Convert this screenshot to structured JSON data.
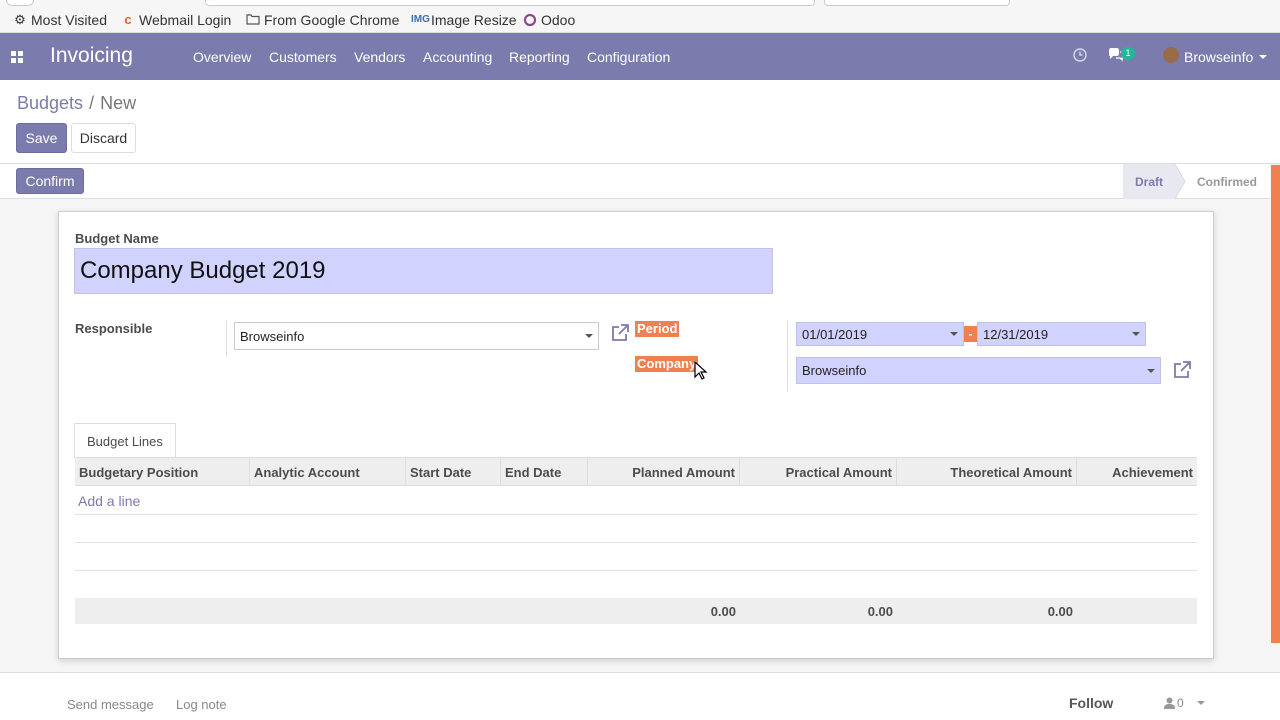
{
  "bookmarks": [
    {
      "label": "Most Visited",
      "icon": "gear-icon"
    },
    {
      "label": "Webmail Login",
      "icon": "cpanel-icon"
    },
    {
      "label": "From Google Chrome",
      "icon": "folder-icon"
    },
    {
      "label": "Image Resize",
      "icon": "img-icon"
    },
    {
      "label": "Odoo",
      "icon": "odoo-icon"
    }
  ],
  "navbar": {
    "app_name": "Invoicing",
    "menu": [
      "Overview",
      "Customers",
      "Vendors",
      "Accounting",
      "Reporting",
      "Configuration"
    ],
    "messages_count": "1",
    "user": "Browseinfo"
  },
  "breadcrumb": {
    "parent": "Budgets",
    "separator": "/",
    "current": "New"
  },
  "buttons": {
    "save": "Save",
    "discard": "Discard",
    "confirm": "Confirm"
  },
  "status": {
    "stages": [
      "Draft",
      "Confirmed"
    ],
    "active": "Draft"
  },
  "form": {
    "budget_name_label": "Budget Name",
    "budget_name": "Company Budget 2019",
    "responsible_label": "Responsible",
    "responsible": "Browseinfo",
    "period_label": "Period",
    "date_from": "01/01/2019",
    "date_separator": "-",
    "date_to": "12/31/2019",
    "company_label": "Company",
    "company": "Browseinfo"
  },
  "lines": {
    "tab_label": "Budget Lines",
    "columns": [
      "Budgetary Position",
      "Analytic Account",
      "Start Date",
      "End Date",
      "Planned Amount",
      "Practical Amount",
      "Theoretical Amount",
      "Achievement"
    ],
    "add_line": "Add a line",
    "totals": {
      "planned": "0.00",
      "practical": "0.00",
      "theoretical": "0.00"
    }
  },
  "chatter": {
    "send_message": "Send message",
    "log_note": "Log note",
    "follow": "Follow",
    "followers": "0"
  },
  "colors": {
    "brand": "#7c7bad",
    "required_field": "#d2d2ff",
    "highlight": "#f0804f"
  }
}
